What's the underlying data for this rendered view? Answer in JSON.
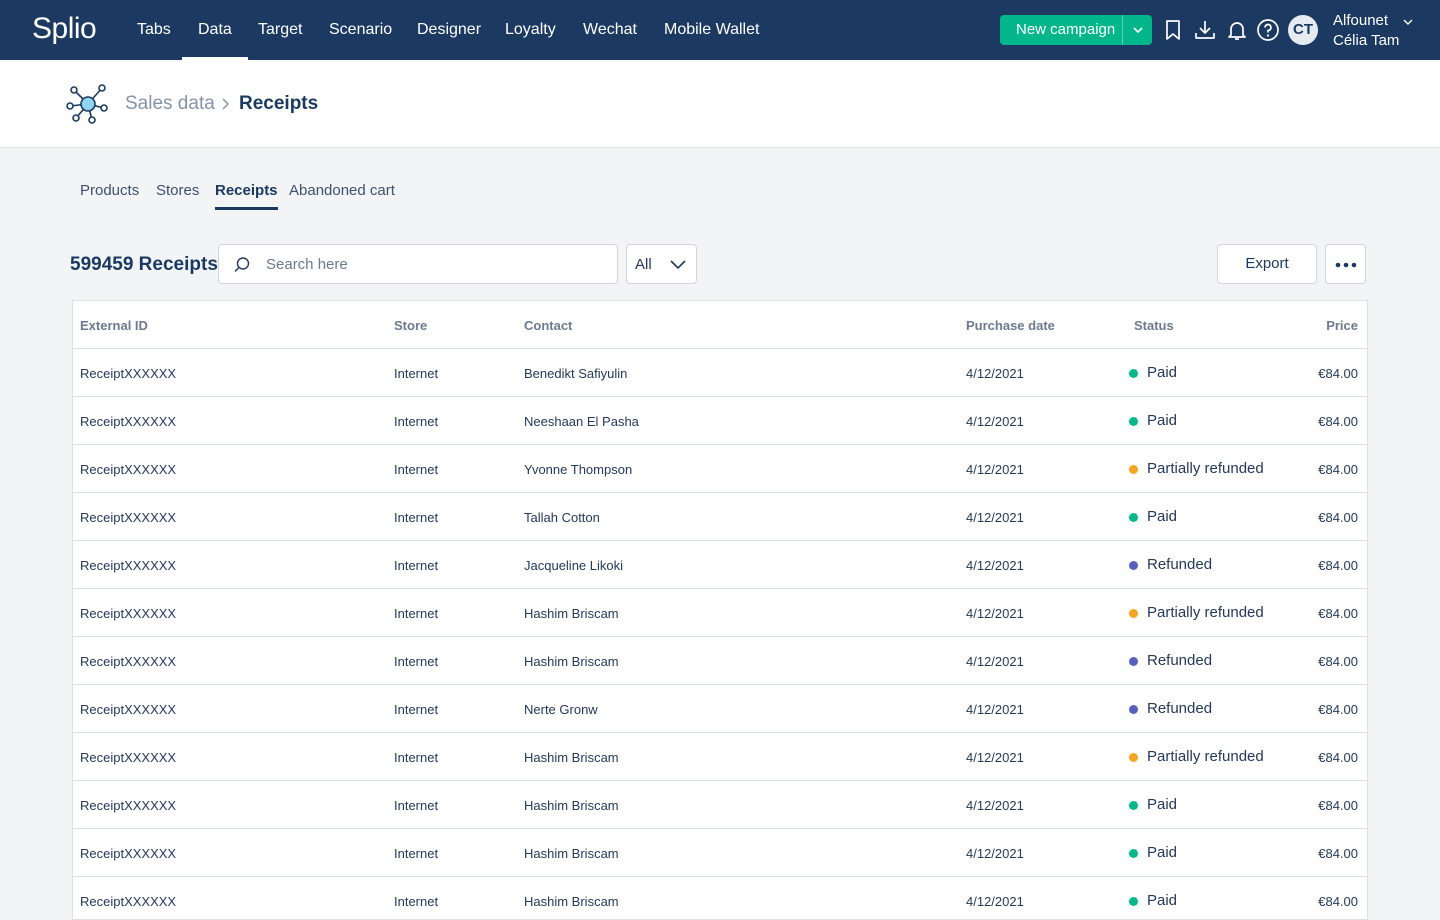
{
  "app": {
    "logo": "Splio"
  },
  "nav": {
    "items": [
      {
        "label": "Tabs"
      },
      {
        "label": "Data"
      },
      {
        "label": "Target"
      },
      {
        "label": "Scenario"
      },
      {
        "label": "Designer"
      },
      {
        "label": "Loyalty"
      },
      {
        "label": "Wechat"
      },
      {
        "label": "Mobile Wallet"
      }
    ],
    "active": "Data",
    "new_campaign_label": "New campaign",
    "icons": [
      "bookmark-icon",
      "download-icon",
      "bell-icon",
      "help-icon"
    ]
  },
  "account": {
    "initials": "CT",
    "company": "Alfounet",
    "user": "Célia Tam"
  },
  "breadcrumb": {
    "parent": "Sales data",
    "current": "Receipts",
    "icon": "network-icon"
  },
  "subtabs": {
    "items": [
      {
        "label": "Products"
      },
      {
        "label": "Stores"
      },
      {
        "label": "Receipts"
      },
      {
        "label": "Abandoned cart"
      }
    ],
    "active": "Receipts"
  },
  "toolbar": {
    "count_label": "599459 Receipts",
    "search_placeholder": "Search here",
    "filter_value": "All",
    "export_label": "Export"
  },
  "colors": {
    "brand": "#1c3a61",
    "accent": "#00b68a",
    "status_paid": "#00b68a",
    "status_partially_refunded": "#f5a623",
    "status_refunded": "#5660b8"
  },
  "table": {
    "columns": [
      "External ID",
      "Store",
      "Contact",
      "Purchase date",
      "Status",
      "Price"
    ],
    "rows": [
      {
        "id": "ReceiptXXXXXX",
        "store": "Internet",
        "contact": "Benedikt Safiyulin",
        "date": "4/12/2021",
        "status": "Paid",
        "price": "€84.00"
      },
      {
        "id": "ReceiptXXXXXX",
        "store": "Internet",
        "contact": "Neeshaan El Pasha",
        "date": "4/12/2021",
        "status": "Paid",
        "price": "€84.00"
      },
      {
        "id": "ReceiptXXXXXX",
        "store": "Internet",
        "contact": "Yvonne Thompson",
        "date": "4/12/2021",
        "status": "Partially refunded",
        "price": "€84.00"
      },
      {
        "id": "ReceiptXXXXXX",
        "store": "Internet",
        "contact": "Tallah Cotton",
        "date": "4/12/2021",
        "status": "Paid",
        "price": "€84.00"
      },
      {
        "id": "ReceiptXXXXXX",
        "store": "Internet",
        "contact": "Jacqueline Likoki",
        "date": "4/12/2021",
        "status": "Refunded",
        "price": "€84.00"
      },
      {
        "id": "ReceiptXXXXXX",
        "store": "Internet",
        "contact": "Hashim Briscam",
        "date": "4/12/2021",
        "status": "Partially refunded",
        "price": "€84.00"
      },
      {
        "id": "ReceiptXXXXXX",
        "store": "Internet",
        "contact": "Hashim Briscam",
        "date": "4/12/2021",
        "status": "Refunded",
        "price": "€84.00"
      },
      {
        "id": "ReceiptXXXXXX",
        "store": "Internet",
        "contact": "Nerte Gronw",
        "date": "4/12/2021",
        "status": "Refunded",
        "price": "€84.00"
      },
      {
        "id": "ReceiptXXXXXX",
        "store": "Internet",
        "contact": "Hashim Briscam",
        "date": "4/12/2021",
        "status": "Partially refunded",
        "price": "€84.00"
      },
      {
        "id": "ReceiptXXXXXX",
        "store": "Internet",
        "contact": "Hashim Briscam",
        "date": "4/12/2021",
        "status": "Paid",
        "price": "€84.00"
      },
      {
        "id": "ReceiptXXXXXX",
        "store": "Internet",
        "contact": "Hashim Briscam",
        "date": "4/12/2021",
        "status": "Paid",
        "price": "€84.00"
      },
      {
        "id": "ReceiptXXXXXX",
        "store": "Internet",
        "contact": "Hashim Briscam",
        "date": "4/12/2021",
        "status": "Paid",
        "price": "€84.00"
      }
    ]
  }
}
